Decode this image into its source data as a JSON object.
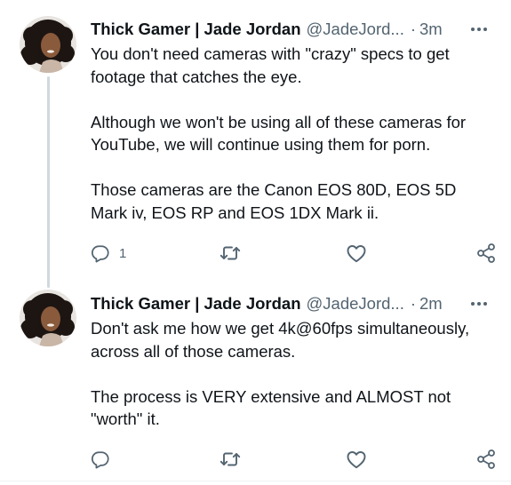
{
  "tweets": [
    {
      "display_name": "Thick Gamer | Jade Jordan",
      "handle": "@JadeJord...",
      "separator": "·",
      "time": "3m",
      "paragraphs": [
        "You don't need cameras with \"crazy\" specs to get footage that catches the eye.",
        "Although we won't be using all of these cameras for YouTube, we will continue using them for porn.",
        "Those cameras are the Canon EOS 80D, EOS 5D Mark iv, EOS RP and EOS 1DX Mark ii."
      ],
      "reply_count": "1",
      "icons": [
        "reply-icon",
        "retweet-icon",
        "like-icon",
        "share-icon",
        "more-icon"
      ]
    },
    {
      "display_name": "Thick Gamer | Jade Jordan",
      "handle": "@JadeJord...",
      "separator": "·",
      "time": "2m",
      "paragraphs": [
        "Don't ask me how we get 4k@60fps simultaneously, across all of those cameras.",
        "The process is VERY extensive and ALMOST not \"worth\" it."
      ],
      "reply_count": "",
      "icons": [
        "reply-icon",
        "retweet-icon",
        "like-icon",
        "share-icon",
        "more-icon"
      ]
    }
  ],
  "colors": {
    "text_primary": "#0f1419",
    "text_secondary": "#536471",
    "thread_line": "#cfd9de",
    "icon": "#536471"
  }
}
